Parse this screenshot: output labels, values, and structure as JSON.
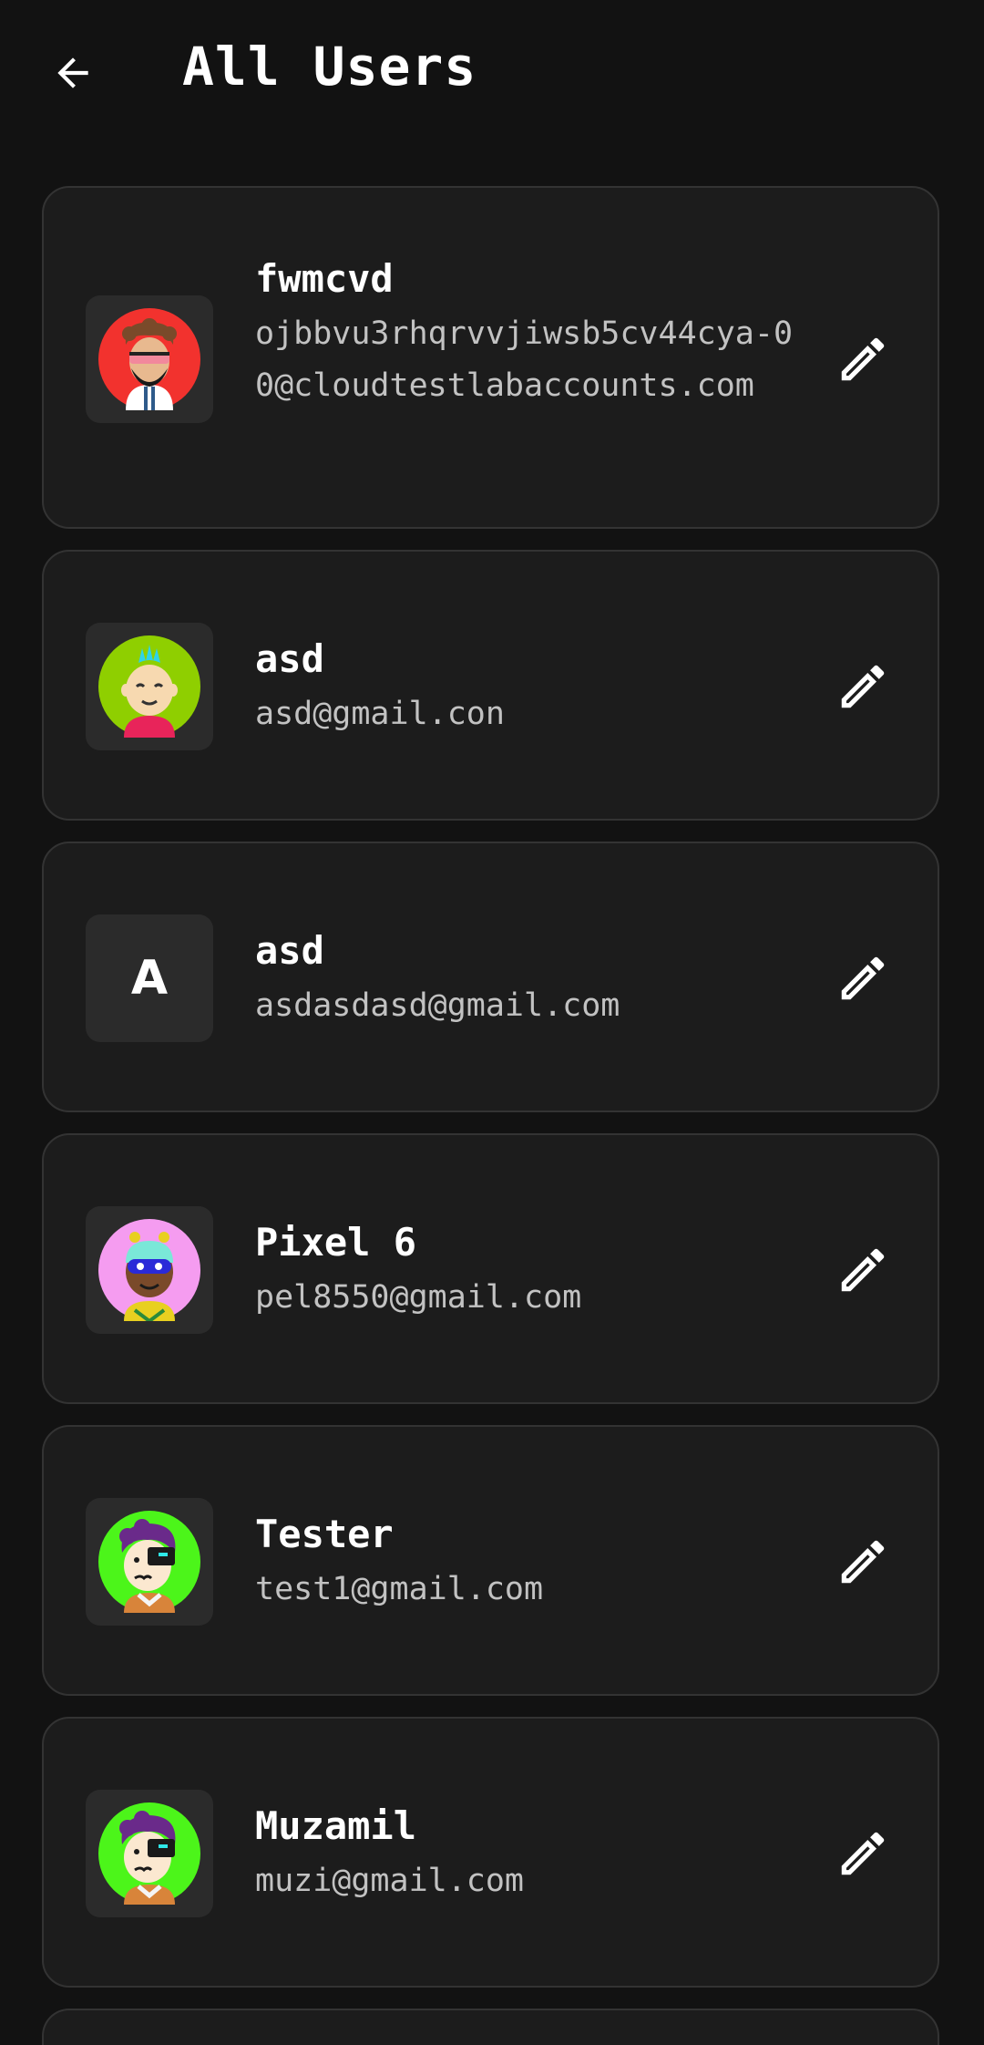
{
  "header": {
    "title": "All Users"
  },
  "users": [
    {
      "name": "fwmcvd",
      "email": "ojbbvu3rhqrvvjiwsb5cv44cya-00@cloudtestlabaccounts.com",
      "avatar": "bearded-man-sunglasses",
      "avatar_bg": "#f2322e"
    },
    {
      "name": "asd",
      "email": "asd@gmail.con",
      "avatar": "smiling-boy-mohawk",
      "avatar_bg": "#8fcf00"
    },
    {
      "name": "asd",
      "email": "asdasdasd@gmail.com",
      "avatar_letter": "A"
    },
    {
      "name": "Pixel 6",
      "email": "pel8550@gmail.com",
      "avatar": "visor-kid",
      "avatar_bg": "#f59cf0"
    },
    {
      "name": "Tester",
      "email": "test1@gmail.com",
      "avatar": "eyepatch-cyborg",
      "avatar_bg": "#4cf51a"
    },
    {
      "name": "Muzamil",
      "email": "muzi@gmail.com",
      "avatar": "eyepatch-cyborg",
      "avatar_bg": "#4cf51a"
    }
  ],
  "icons": {
    "back": "arrow-left-icon",
    "edit": "pencil-icon"
  }
}
